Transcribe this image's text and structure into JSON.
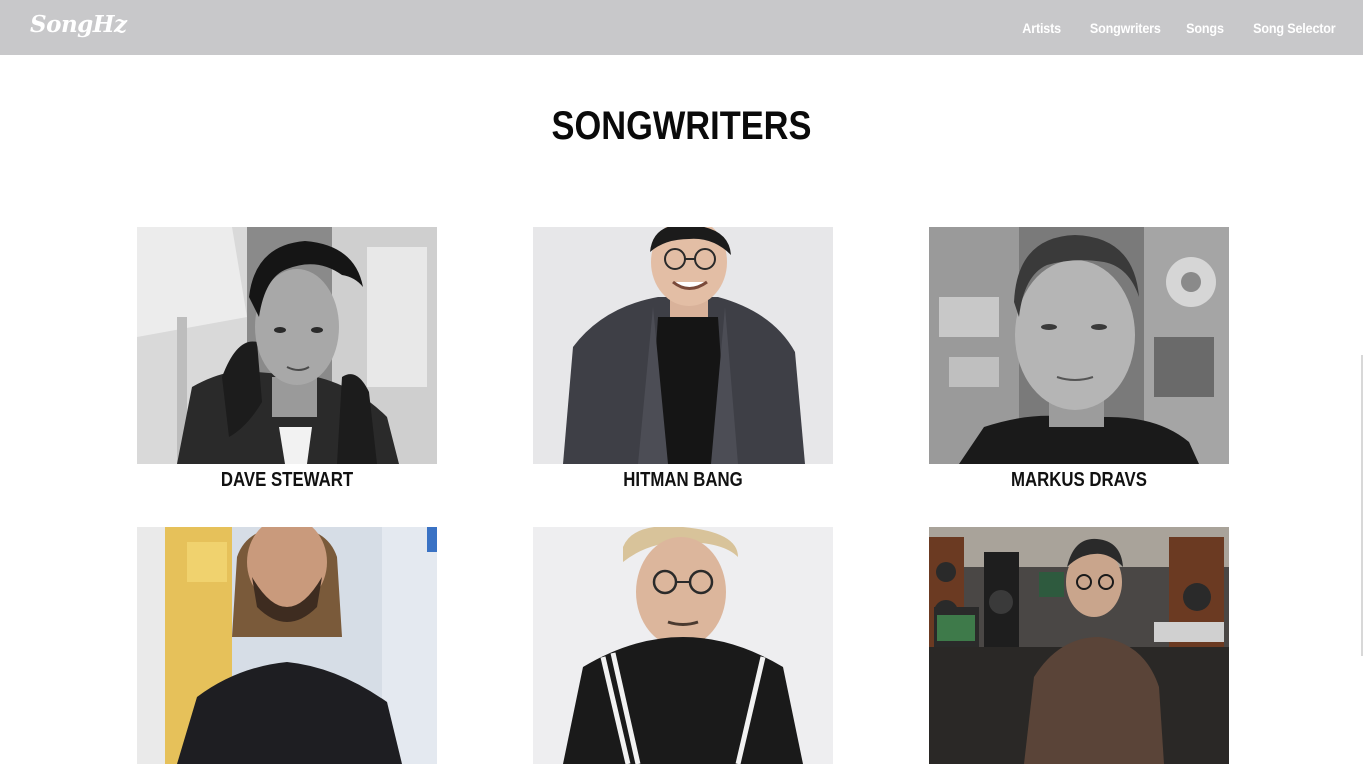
{
  "brand": {
    "logo": "SongHz"
  },
  "nav": {
    "items": [
      {
        "label": "Artists"
      },
      {
        "label": "Songwriters"
      },
      {
        "label": "Songs"
      },
      {
        "label": "Song Selector"
      }
    ]
  },
  "page": {
    "title": "SONGWRITERS"
  },
  "songwriters": [
    {
      "name": "DAVE STEWART",
      "photo": "dave-stewart-photo"
    },
    {
      "name": "HITMAN BANG",
      "photo": "hitman-bang-photo"
    },
    {
      "name": "MARKUS DRAVS",
      "photo": "markus-dravs-photo"
    },
    {
      "name": "",
      "photo": "songwriter-4-photo"
    },
    {
      "name": "",
      "photo": "songwriter-5-photo"
    },
    {
      "name": "",
      "photo": "songwriter-6-photo"
    }
  ]
}
